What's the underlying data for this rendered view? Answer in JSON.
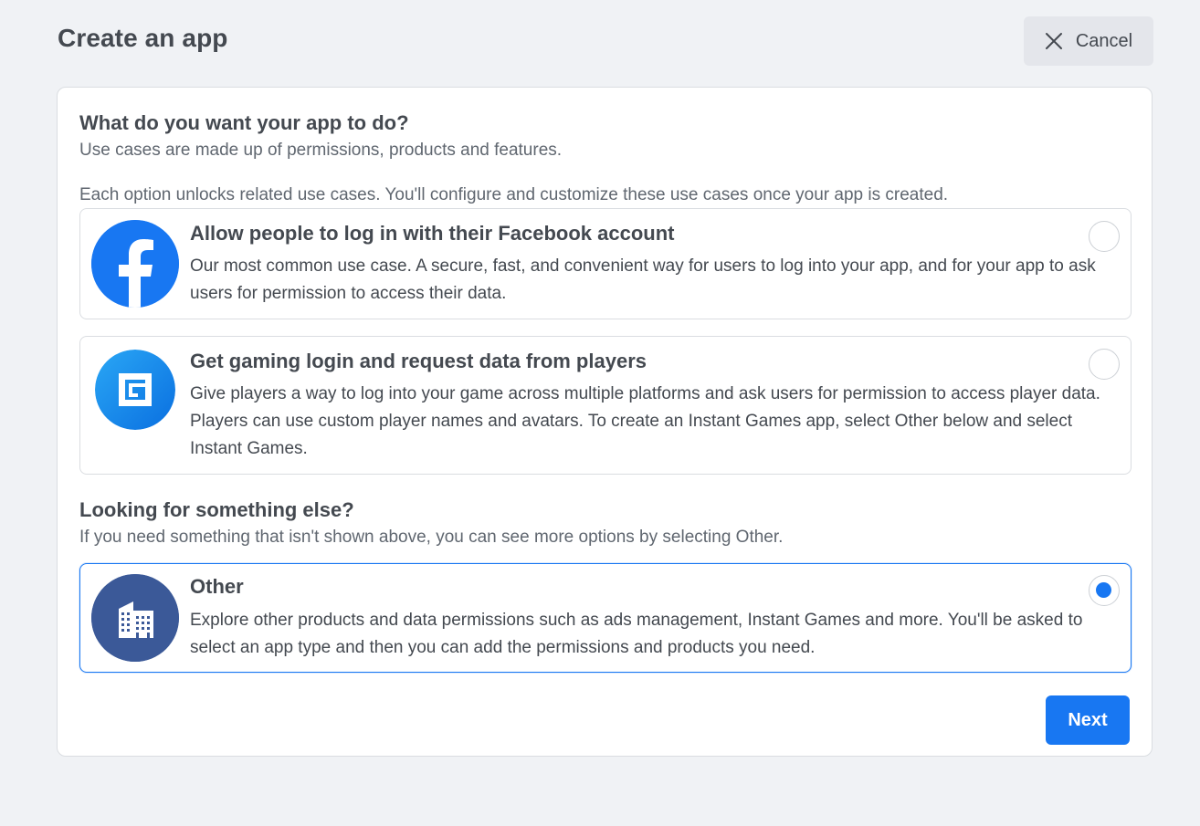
{
  "header": {
    "title": "Create an app",
    "cancel_label": "Cancel"
  },
  "intro": {
    "heading": "What do you want your app to do?",
    "subtitle": "Use cases are made up of permissions, products and features.",
    "note": "Each option unlocks related use cases. You'll configure and customize these use cases once your app is created."
  },
  "options": [
    {
      "icon": "facebook-logo-icon",
      "title": "Allow people to log in with their Facebook account",
      "description": "Our most common use case. A secure, fast, and convenient way for users to log into your app, and for your app to ask users for permission to access their data.",
      "selected": false
    },
    {
      "icon": "facebook-gaming-icon",
      "title": "Get gaming login and request data from players",
      "description": "Give players a way to log into your game across multiple platforms and ask users for permission to access player data. Players can use custom player names and avatars. To create an Instant Games app, select Other below and select Instant Games.",
      "selected": false
    }
  ],
  "other_section": {
    "heading": "Looking for something else?",
    "subtitle": "If you need something that isn't shown above, you can see more options by selecting Other.",
    "option": {
      "icon": "building-icon",
      "title": "Other",
      "description": "Explore other products and data permissions such as ads management, Instant Games and more. You'll be asked to select an app type and then you can add the permissions and products you need.",
      "selected": true
    }
  },
  "footer": {
    "next_label": "Next"
  },
  "colors": {
    "accent": "#1877f2",
    "background": "#f0f2f5",
    "other_icon_bg": "#3b5998"
  }
}
